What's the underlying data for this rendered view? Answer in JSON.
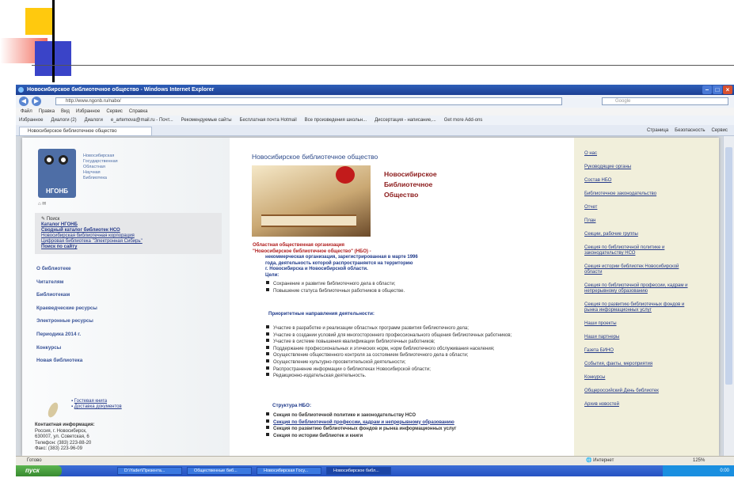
{
  "window": {
    "title": "Новосибирское библиотечное общество - Windows Internet Explorer",
    "address": "http://www.ngonb.ru/nabo/",
    "search_placeholder": "Google"
  },
  "menu": [
    "Файл",
    "Правка",
    "Вид",
    "Избранное",
    "Сервис",
    "Справка"
  ],
  "favorites": [
    "Избранное",
    "Диалоги (2)",
    "Диалоги",
    "e_artemova@mail.ru - Почт...",
    "Рекомендуемые сайты",
    "Бесплатная почта Hotmail",
    "Все произведения школьн...",
    "Диссертация - написание,...",
    "Get more Add-ons"
  ],
  "tab_label": "Новосибирское библиотечное общество",
  "command_bar": [
    "Страница",
    "Безопасность",
    "Сервис"
  ],
  "left": {
    "logo_text": "НГОНБ",
    "org_lines": [
      "Новосибирская",
      "Государственная",
      "Областная",
      "Научная",
      "Библиотека"
    ],
    "search_label": "Поиск",
    "search_links": [
      "Каталог НГОНБ",
      "Сводный каталог библиотек НСО",
      "Новосибирская библиотечная корпорация",
      "Цифровая библиотека \"Электронная Сибирь\"",
      "Поиск по сайту"
    ],
    "nav": [
      "О библиотеке",
      "Читателям",
      "Библиотекам",
      "Краеведческие ресурсы",
      "Электронные ресурсы",
      "Периодика 2014 г.",
      "Конкурсы",
      "Новая библиотека"
    ],
    "guest_links": [
      "Гостевая книга",
      "Доставка документов"
    ],
    "contact_title": "Контактная информация:",
    "contact_lines": [
      "Россия, г. Новосибирск,",
      "630007, ул. Советская, 6",
      "Телефон: (383) 223-88-20",
      "Факс: (383) 223-96-09"
    ]
  },
  "center": {
    "page_title": "Новосибирское библиотечное общество",
    "big_name": [
      "Новосибирское",
      "Библиотечное",
      "Общество"
    ],
    "intro_line1": "Областная общественная организация",
    "intro_line2": "\"Новосибирское библиотечное общество\" (НБО) -",
    "intro_lines": [
      "некоммерческая организация, зарегистрированная в марте 1996",
      "года, деятельность которой распространяется на территорию",
      "г. Новосибирска и Новосибирской области."
    ],
    "goals_label": "Цели:",
    "goals": [
      "Сохранение и развитие библиотечного дела в области;",
      "Повышение статуса библиотечных работников в обществе."
    ],
    "directions_title": "Приоритетные направления деятельности:",
    "directions": [
      "Участие в разработке и реализации областных программ развития библиотечного дела;",
      "Участие в создании условий для многостороннего профессионального общения библиотечных работников;",
      "Участие в системе повышения квалификации библиотечных работников;",
      "Поддержание профессиональных и этических норм, норм библиотечного обслуживания населения;",
      "Осуществление общественного контроля за состоянием библиотечного дела в области;",
      "Осуществление культурно-просветительской деятельности;",
      "Распространение информации о библиотеках Новосибирской области;",
      "Редакционно-издательская деятельность."
    ],
    "structure_title": "Структура НБО:",
    "structure": [
      "Секция по библиотечной политике и законодательству НСО",
      "Секция по библиотечной профессии, кадрам и непрерывному образованию",
      "Секция по развитию библиотечных фондов и рынка информационных услуг",
      "Секция по истории библиотек и книги"
    ]
  },
  "right_links": [
    "О нас",
    "Руководящие органы",
    "Состав НБО",
    "Библиотечное законодательство",
    "Отчет",
    "План",
    "Секции, рабочие группы",
    "Секция по библиотечной политике и законодательству НСО",
    "Секция истории библиотек Новосибирской области",
    "Секция по библиотечной профессии, кадрам и непрерывному образованию",
    "Секция по развитию библиотечных фондов и рынка информационных услуг",
    "Наши проекты",
    "Наши партнеры",
    "Газета БИНО",
    "События, факты, мероприятия",
    "Конкурсы",
    "Общероссийский День библиотек",
    "Архив новостей"
  ],
  "status": {
    "left": "Готово",
    "zone": "Интернет",
    "zoom": "125%"
  },
  "taskbar": {
    "start": "пуск",
    "tasks": [
      "D:\\Yader\\Презента...",
      "Общественные биб...",
      "Новосибирская Госу...",
      "Новосибирское библ..."
    ],
    "clock": "0:00"
  },
  "colors": {
    "link": "#253a8a",
    "accent_red": "#b01c1c",
    "sidebar_bg": "#f1efdb",
    "titlebar": "#2f5fb8"
  }
}
